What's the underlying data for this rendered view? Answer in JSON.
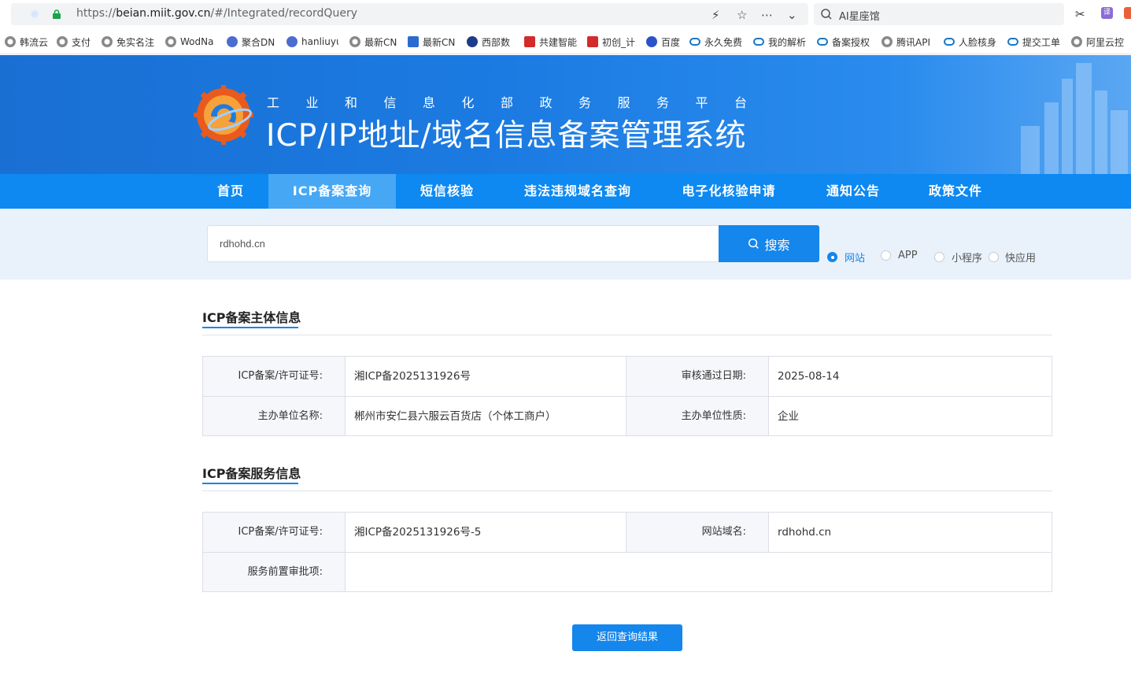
{
  "browser": {
    "url_prefix": "https://",
    "url_host": "beian.miit.gov.cn",
    "url_path": "/#/Integrated/recordQuery",
    "search_placeholder": "AI星座馆",
    "translate_label": "译",
    "bookmarks": [
      {
        "label": "韩流云",
        "icon": "globe-icon"
      },
      {
        "label": "支付",
        "icon": "globe-icon"
      },
      {
        "label": "免实名注",
        "icon": "globe-icon"
      },
      {
        "label": "WodNa",
        "icon": "globe-icon"
      },
      {
        "label": "聚合DN",
        "icon": "dns-icon"
      },
      {
        "label": "hanliuyu",
        "icon": "dns-icon"
      },
      {
        "label": "最新CN",
        "icon": "globe-icon"
      },
      {
        "label": "最新CN",
        "icon": "square-blue-icon"
      },
      {
        "label": "西部数",
        "icon": "navy-icon"
      },
      {
        "label": "共建智能",
        "icon": "huawei-icon"
      },
      {
        "label": "初创_计",
        "icon": "huawei-icon"
      },
      {
        "label": "百度",
        "icon": "baidu-paw-icon"
      },
      {
        "label": "永久免费",
        "icon": "cloud-icon"
      },
      {
        "label": "我的解析",
        "icon": "cloud-icon"
      },
      {
        "label": "备案授权",
        "icon": "cloud-icon"
      },
      {
        "label": "腾讯API",
        "icon": "globe-icon"
      },
      {
        "label": "人脸核身",
        "icon": "cloud-icon"
      },
      {
        "label": "提交工单",
        "icon": "cloud-icon"
      },
      {
        "label": "阿里云控",
        "icon": "globe-icon"
      }
    ]
  },
  "header": {
    "subtitle": "工业和信息化部政务服务平台",
    "title": "ICP/IP地址/域名信息备案管理系统"
  },
  "nav": [
    {
      "label": "首页",
      "active": false
    },
    {
      "label": "ICP备案查询",
      "active": true
    },
    {
      "label": "短信核验",
      "active": false
    },
    {
      "label": "违法违规域名查询",
      "active": false
    },
    {
      "label": "电子化核验申请",
      "active": false
    },
    {
      "label": "通知公告",
      "active": false
    },
    {
      "label": "政策文件",
      "active": false
    }
  ],
  "search": {
    "value": "rdhohd.cn",
    "button_label": "搜索",
    "types": [
      {
        "label": "网站",
        "checked": true
      },
      {
        "label": "APP",
        "checked": false
      },
      {
        "label": "小程序",
        "checked": false
      },
      {
        "label": "快应用",
        "checked": false
      }
    ]
  },
  "subject_info": {
    "title": "ICP备案主体信息",
    "license_label": "ICP备案/许可证号:",
    "license_value": "湘ICP备2025131926号",
    "approve_date_label": "审核通过日期:",
    "approve_date_value": "2025-08-14",
    "org_name_label": "主办单位名称:",
    "org_name_value": "郴州市安仁县六服云百货店（个体工商户）",
    "org_type_label": "主办单位性质:",
    "org_type_value": "企业"
  },
  "service_info": {
    "title": "ICP备案服务信息",
    "license_label": "ICP备案/许可证号:",
    "license_value": "湘ICP备2025131926号-5",
    "domain_label": "网站域名:",
    "domain_value": "rdhohd.cn",
    "pre_approval_label": "服务前置审批项:",
    "pre_approval_value": ""
  },
  "back_button_label": "返回查询结果",
  "colors": {
    "primary": "#1486ec",
    "nav_bg": "#0d89f1",
    "nav_active": "#46a7f5",
    "banner": "#1b7be2",
    "search_band": "#e9f2fb"
  }
}
